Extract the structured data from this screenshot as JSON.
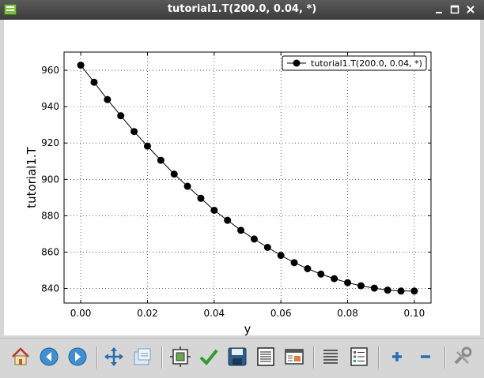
{
  "window": {
    "title": "tutorial1.T(200.0, 0.04, *)",
    "controls": [
      "minimize",
      "maximize",
      "close"
    ]
  },
  "chart_data": {
    "type": "line",
    "title": "",
    "xlabel": "y",
    "ylabel": "tutorial1.T",
    "xlim": [
      -0.005,
      0.105
    ],
    "ylim": [
      832,
      970
    ],
    "xticks": [
      0.0,
      0.02,
      0.04,
      0.06,
      0.08,
      0.1
    ],
    "xtick_labels": [
      "0.00",
      "0.02",
      "0.04",
      "0.06",
      "0.08",
      "0.10"
    ],
    "yticks": [
      840,
      860,
      880,
      900,
      920,
      940,
      960
    ],
    "ytick_labels": [
      "840",
      "860",
      "880",
      "900",
      "920",
      "940",
      "960"
    ],
    "grid": true,
    "legend_position": "top-right",
    "series": [
      {
        "name": "tutorial1.T(200.0, 0.04, *)",
        "color": "#000000",
        "marker": "circle",
        "x": [
          0.0,
          0.004,
          0.008,
          0.012,
          0.016,
          0.02,
          0.024,
          0.028,
          0.032,
          0.036,
          0.04,
          0.044,
          0.048,
          0.052,
          0.056,
          0.06,
          0.064,
          0.068,
          0.072,
          0.076,
          0.08,
          0.084,
          0.088,
          0.092,
          0.096,
          0.1
        ],
        "y": [
          962.8,
          953.4,
          943.9,
          935.0,
          926.3,
          918.3,
          910.5,
          902.9,
          896.2,
          889.6,
          883.0,
          877.5,
          872.0,
          867.2,
          862.6,
          858.2,
          854.2,
          850.9,
          847.9,
          845.4,
          843.2,
          841.5,
          840.2,
          839.1,
          838.6,
          838.6
        ]
      }
    ]
  },
  "toolbar": {
    "buttons": [
      {
        "icon": "home-icon",
        "name": "home-button"
      },
      {
        "icon": "back-icon",
        "name": "back-button"
      },
      {
        "icon": "forward-icon",
        "name": "forward-button"
      },
      {
        "icon": "pan-icon",
        "name": "pan-button"
      },
      {
        "icon": "zoom-icon",
        "name": "zoom-button"
      },
      {
        "icon": "subplots-icon",
        "name": "configure-subplots-button"
      },
      {
        "icon": "check-icon",
        "name": "edit-parameters-button"
      },
      {
        "icon": "save-icon",
        "name": "save-button"
      },
      {
        "icon": "document-icon",
        "name": "document-button"
      },
      {
        "icon": "window-icon",
        "name": "window-button"
      },
      {
        "icon": "list-icon",
        "name": "list-button"
      },
      {
        "icon": "legend-icon",
        "name": "legend-button"
      },
      {
        "icon": "plus-icon",
        "name": "add-button"
      },
      {
        "icon": "minus-icon",
        "name": "remove-button"
      },
      {
        "icon": "tools-icon",
        "name": "tools-button"
      }
    ]
  }
}
